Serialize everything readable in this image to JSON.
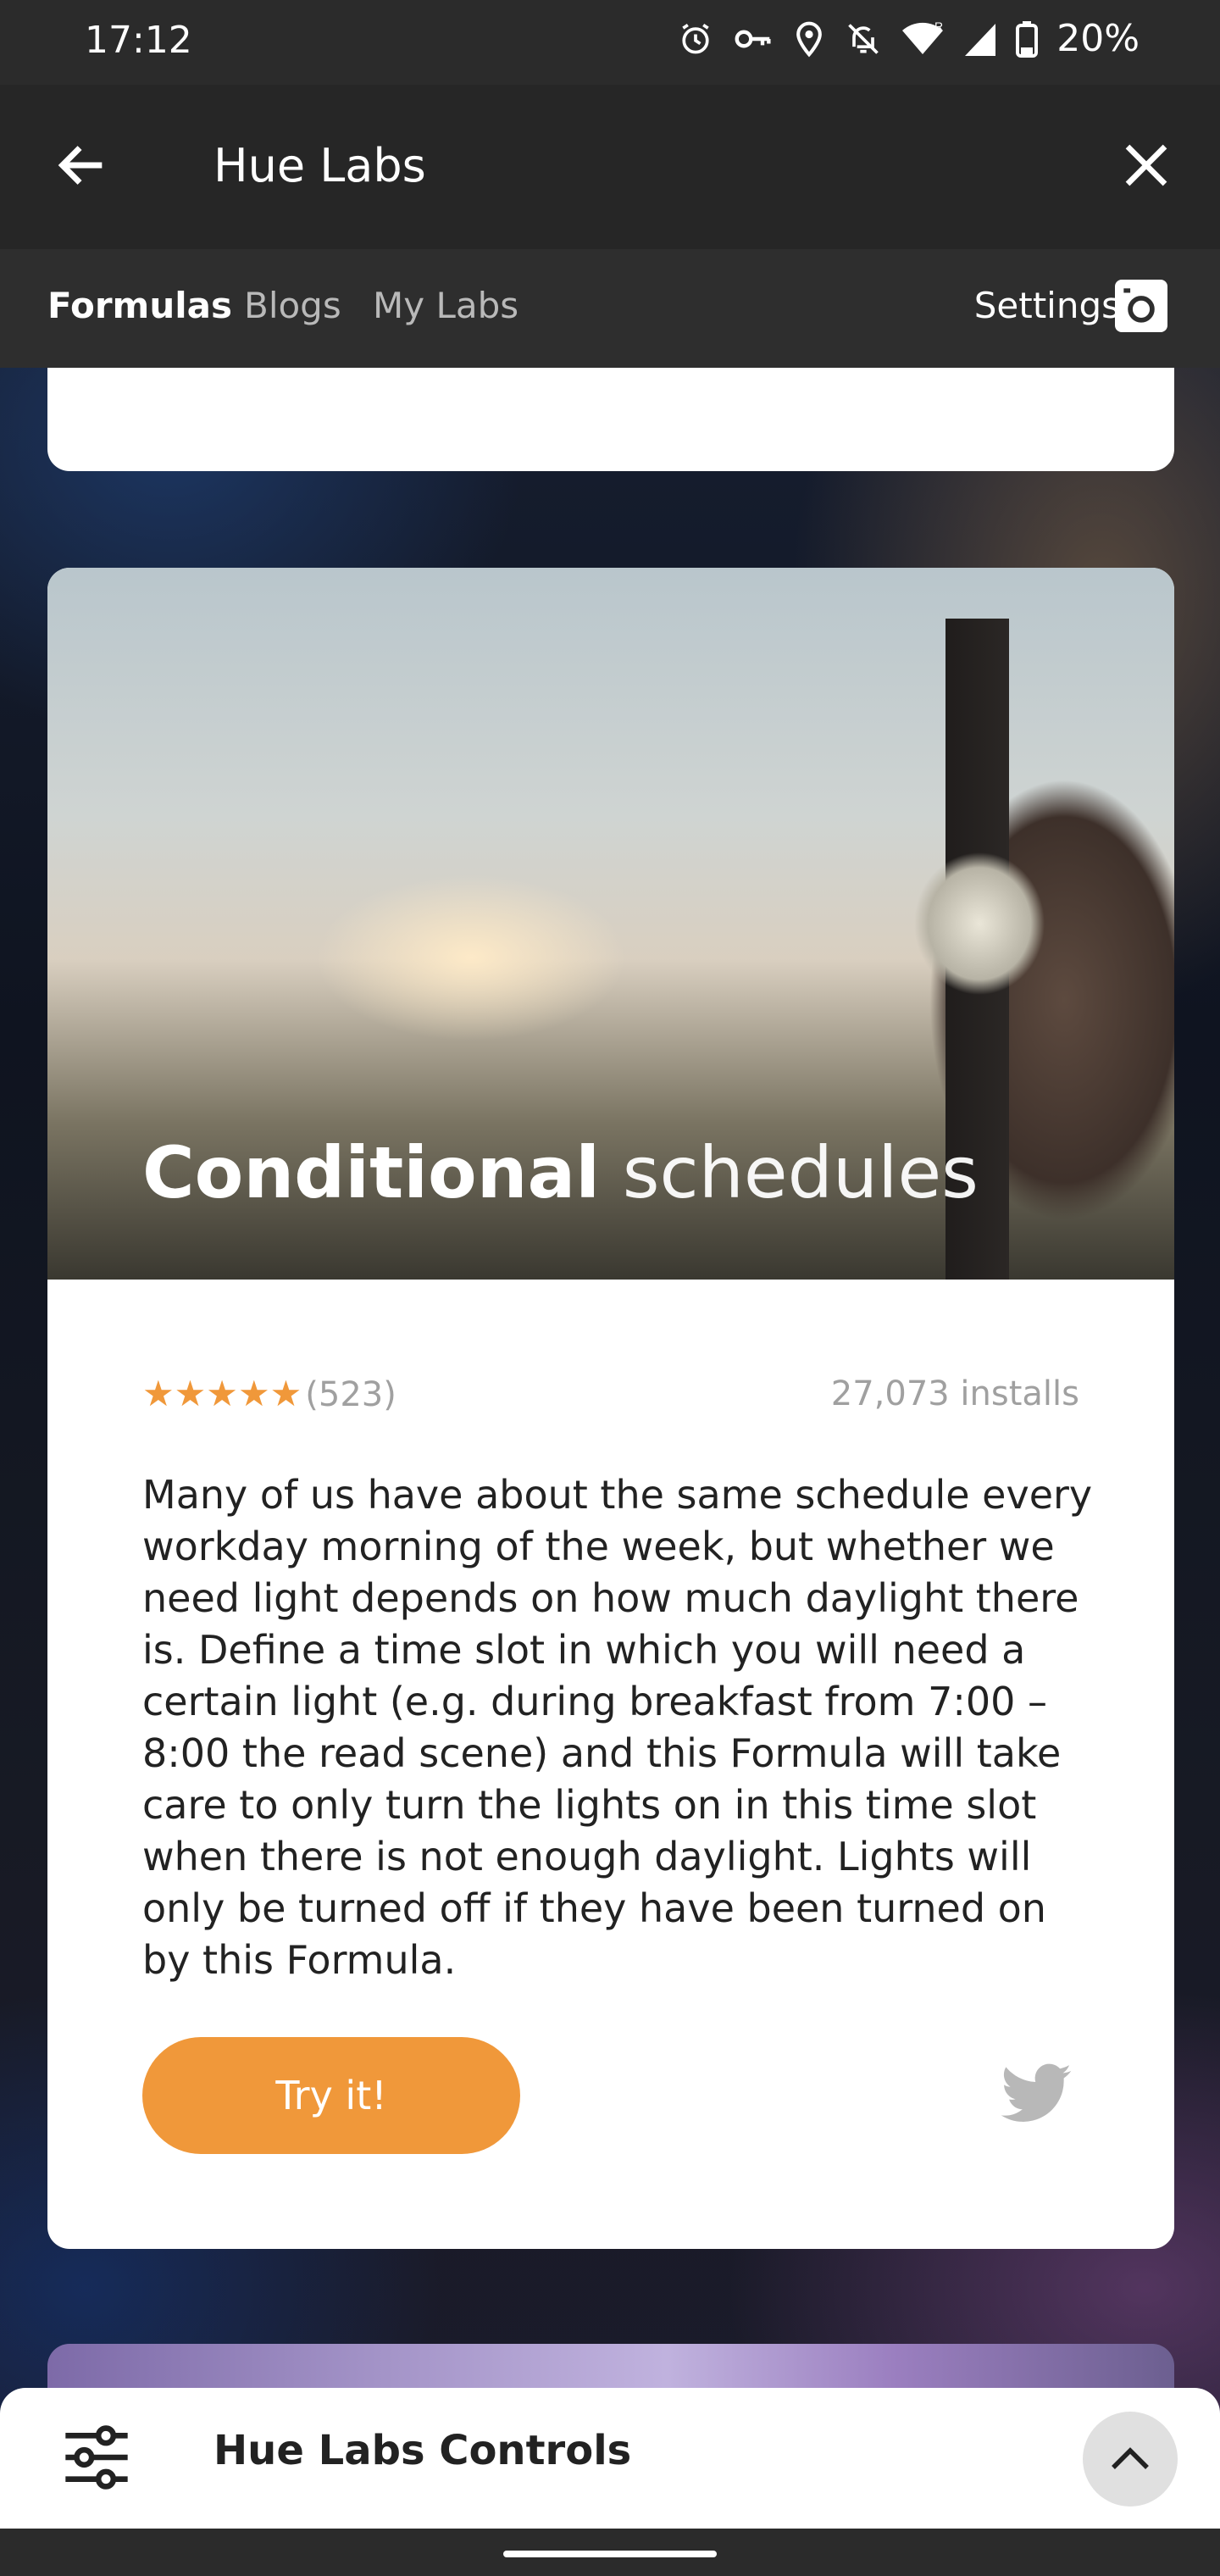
{
  "status": {
    "time": "17:12",
    "battery": "20%",
    "icons": [
      "alarm-icon",
      "key-icon",
      "location-icon",
      "notifications-off-icon",
      "wifi-icon",
      "signal-icon",
      "battery-icon"
    ]
  },
  "appbar": {
    "title": "Hue Labs"
  },
  "tabs": [
    {
      "label": "Formulas",
      "active": true
    },
    {
      "label": "Blogs",
      "active": false
    },
    {
      "label": "My Labs",
      "active": false
    }
  ],
  "settings": {
    "label": "Settings"
  },
  "card": {
    "title_bold": "Conditional",
    "title_light": "schedules",
    "stars": "★★★★★",
    "rating_count": "(523)",
    "installs": "27,073 installs",
    "description": "Many of us have about the same schedule every workday morning of the week, but whether we need light depends on how much daylight there is. Define a time slot in which you will need a certain light (e.g. during breakfast from 7:00 – 8:00 the read scene) and this Formula will take care to only turn the lights on in this time slot when there is not enough daylight. Lights will only be turned off if they have been turned on by this Formula.",
    "button": "Try it!"
  },
  "sheet": {
    "label": "Hue Labs Controls"
  },
  "colors": {
    "accent": "#f0983a"
  }
}
